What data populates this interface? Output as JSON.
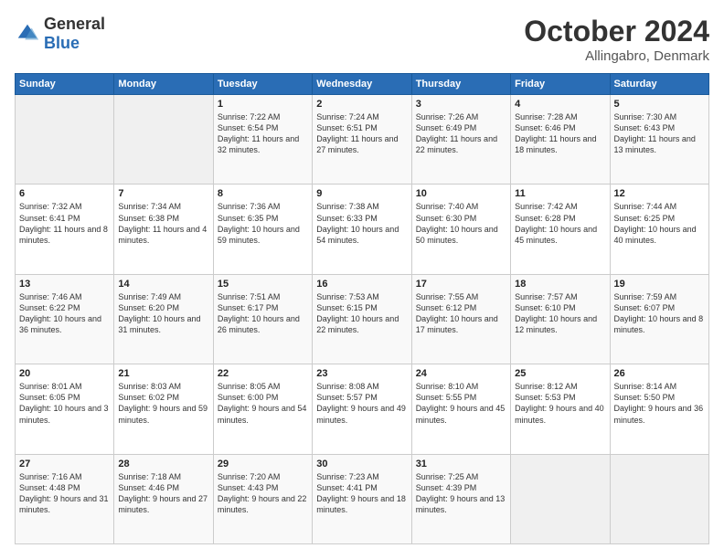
{
  "header": {
    "logo_general": "General",
    "logo_blue": "Blue",
    "month": "October 2024",
    "location": "Allingabro, Denmark"
  },
  "weekdays": [
    "Sunday",
    "Monday",
    "Tuesday",
    "Wednesday",
    "Thursday",
    "Friday",
    "Saturday"
  ],
  "weeks": [
    [
      {
        "day": "",
        "sunrise": "",
        "sunset": "",
        "daylight": ""
      },
      {
        "day": "",
        "sunrise": "",
        "sunset": "",
        "daylight": ""
      },
      {
        "day": "1",
        "sunrise": "Sunrise: 7:22 AM",
        "sunset": "Sunset: 6:54 PM",
        "daylight": "Daylight: 11 hours and 32 minutes."
      },
      {
        "day": "2",
        "sunrise": "Sunrise: 7:24 AM",
        "sunset": "Sunset: 6:51 PM",
        "daylight": "Daylight: 11 hours and 27 minutes."
      },
      {
        "day": "3",
        "sunrise": "Sunrise: 7:26 AM",
        "sunset": "Sunset: 6:49 PM",
        "daylight": "Daylight: 11 hours and 22 minutes."
      },
      {
        "day": "4",
        "sunrise": "Sunrise: 7:28 AM",
        "sunset": "Sunset: 6:46 PM",
        "daylight": "Daylight: 11 hours and 18 minutes."
      },
      {
        "day": "5",
        "sunrise": "Sunrise: 7:30 AM",
        "sunset": "Sunset: 6:43 PM",
        "daylight": "Daylight: 11 hours and 13 minutes."
      }
    ],
    [
      {
        "day": "6",
        "sunrise": "Sunrise: 7:32 AM",
        "sunset": "Sunset: 6:41 PM",
        "daylight": "Daylight: 11 hours and 8 minutes."
      },
      {
        "day": "7",
        "sunrise": "Sunrise: 7:34 AM",
        "sunset": "Sunset: 6:38 PM",
        "daylight": "Daylight: 11 hours and 4 minutes."
      },
      {
        "day": "8",
        "sunrise": "Sunrise: 7:36 AM",
        "sunset": "Sunset: 6:35 PM",
        "daylight": "Daylight: 10 hours and 59 minutes."
      },
      {
        "day": "9",
        "sunrise": "Sunrise: 7:38 AM",
        "sunset": "Sunset: 6:33 PM",
        "daylight": "Daylight: 10 hours and 54 minutes."
      },
      {
        "day": "10",
        "sunrise": "Sunrise: 7:40 AM",
        "sunset": "Sunset: 6:30 PM",
        "daylight": "Daylight: 10 hours and 50 minutes."
      },
      {
        "day": "11",
        "sunrise": "Sunrise: 7:42 AM",
        "sunset": "Sunset: 6:28 PM",
        "daylight": "Daylight: 10 hours and 45 minutes."
      },
      {
        "day": "12",
        "sunrise": "Sunrise: 7:44 AM",
        "sunset": "Sunset: 6:25 PM",
        "daylight": "Daylight: 10 hours and 40 minutes."
      }
    ],
    [
      {
        "day": "13",
        "sunrise": "Sunrise: 7:46 AM",
        "sunset": "Sunset: 6:22 PM",
        "daylight": "Daylight: 10 hours and 36 minutes."
      },
      {
        "day": "14",
        "sunrise": "Sunrise: 7:49 AM",
        "sunset": "Sunset: 6:20 PM",
        "daylight": "Daylight: 10 hours and 31 minutes."
      },
      {
        "day": "15",
        "sunrise": "Sunrise: 7:51 AM",
        "sunset": "Sunset: 6:17 PM",
        "daylight": "Daylight: 10 hours and 26 minutes."
      },
      {
        "day": "16",
        "sunrise": "Sunrise: 7:53 AM",
        "sunset": "Sunset: 6:15 PM",
        "daylight": "Daylight: 10 hours and 22 minutes."
      },
      {
        "day": "17",
        "sunrise": "Sunrise: 7:55 AM",
        "sunset": "Sunset: 6:12 PM",
        "daylight": "Daylight: 10 hours and 17 minutes."
      },
      {
        "day": "18",
        "sunrise": "Sunrise: 7:57 AM",
        "sunset": "Sunset: 6:10 PM",
        "daylight": "Daylight: 10 hours and 12 minutes."
      },
      {
        "day": "19",
        "sunrise": "Sunrise: 7:59 AM",
        "sunset": "Sunset: 6:07 PM",
        "daylight": "Daylight: 10 hours and 8 minutes."
      }
    ],
    [
      {
        "day": "20",
        "sunrise": "Sunrise: 8:01 AM",
        "sunset": "Sunset: 6:05 PM",
        "daylight": "Daylight: 10 hours and 3 minutes."
      },
      {
        "day": "21",
        "sunrise": "Sunrise: 8:03 AM",
        "sunset": "Sunset: 6:02 PM",
        "daylight": "Daylight: 9 hours and 59 minutes."
      },
      {
        "day": "22",
        "sunrise": "Sunrise: 8:05 AM",
        "sunset": "Sunset: 6:00 PM",
        "daylight": "Daylight: 9 hours and 54 minutes."
      },
      {
        "day": "23",
        "sunrise": "Sunrise: 8:08 AM",
        "sunset": "Sunset: 5:57 PM",
        "daylight": "Daylight: 9 hours and 49 minutes."
      },
      {
        "day": "24",
        "sunrise": "Sunrise: 8:10 AM",
        "sunset": "Sunset: 5:55 PM",
        "daylight": "Daylight: 9 hours and 45 minutes."
      },
      {
        "day": "25",
        "sunrise": "Sunrise: 8:12 AM",
        "sunset": "Sunset: 5:53 PM",
        "daylight": "Daylight: 9 hours and 40 minutes."
      },
      {
        "day": "26",
        "sunrise": "Sunrise: 8:14 AM",
        "sunset": "Sunset: 5:50 PM",
        "daylight": "Daylight: 9 hours and 36 minutes."
      }
    ],
    [
      {
        "day": "27",
        "sunrise": "Sunrise: 7:16 AM",
        "sunset": "Sunset: 4:48 PM",
        "daylight": "Daylight: 9 hours and 31 minutes."
      },
      {
        "day": "28",
        "sunrise": "Sunrise: 7:18 AM",
        "sunset": "Sunset: 4:46 PM",
        "daylight": "Daylight: 9 hours and 27 minutes."
      },
      {
        "day": "29",
        "sunrise": "Sunrise: 7:20 AM",
        "sunset": "Sunset: 4:43 PM",
        "daylight": "Daylight: 9 hours and 22 minutes."
      },
      {
        "day": "30",
        "sunrise": "Sunrise: 7:23 AM",
        "sunset": "Sunset: 4:41 PM",
        "daylight": "Daylight: 9 hours and 18 minutes."
      },
      {
        "day": "31",
        "sunrise": "Sunrise: 7:25 AM",
        "sunset": "Sunset: 4:39 PM",
        "daylight": "Daylight: 9 hours and 13 minutes."
      },
      {
        "day": "",
        "sunrise": "",
        "sunset": "",
        "daylight": ""
      },
      {
        "day": "",
        "sunrise": "",
        "sunset": "",
        "daylight": ""
      }
    ]
  ]
}
